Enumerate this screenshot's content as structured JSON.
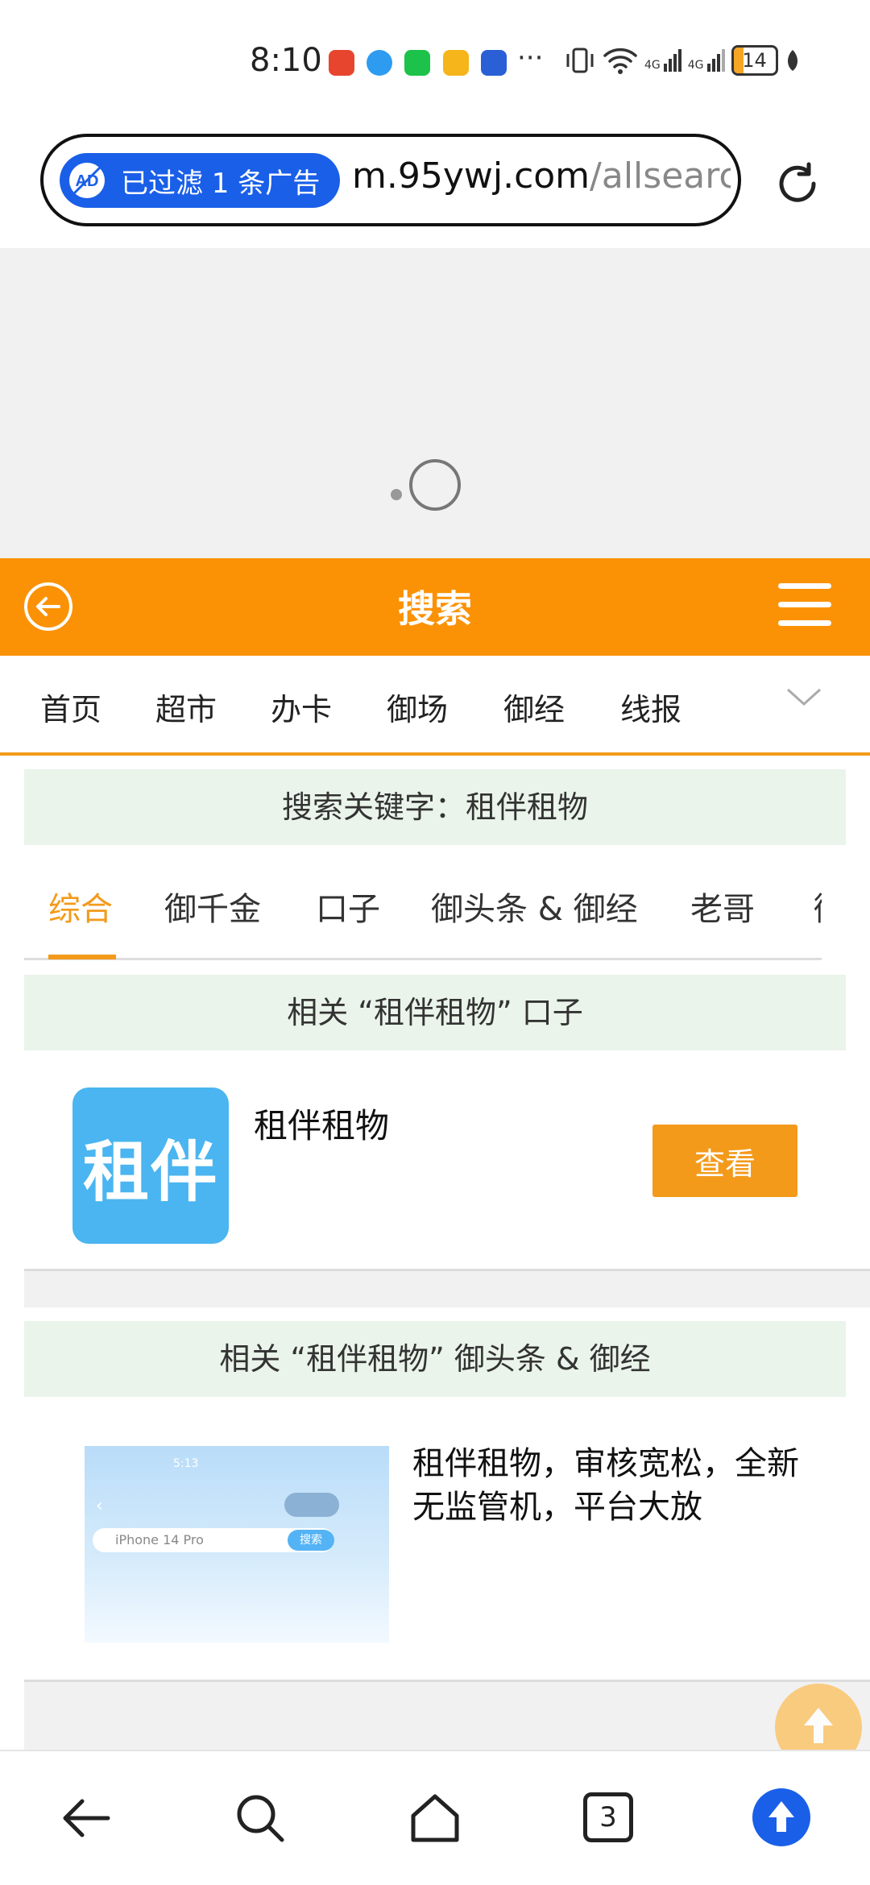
{
  "status_bar": {
    "time": "8:10",
    "notification_icons": [
      "missed-call-icon",
      "message-icon",
      "wechat-icon",
      "mail-icon",
      "shield-app-icon"
    ],
    "more": "···",
    "network": "4G",
    "battery": "14"
  },
  "browser": {
    "ad_filter_label": "已过滤 1 条广告",
    "url_domain": "m.95ywj.com",
    "url_path": "/allsearcl"
  },
  "header": {
    "title": "搜索"
  },
  "nav": {
    "items": [
      "首页",
      "超市",
      "办卡",
      "御场",
      "御经",
      "线报"
    ]
  },
  "search": {
    "keyword_banner": "搜索关键字：租伴租物"
  },
  "tabs": {
    "items": [
      "综合",
      "御千金",
      "口子",
      "御头条 & 御经",
      "老哥",
      "御"
    ],
    "active": "综合"
  },
  "section_kouzi": {
    "title": "相关 “租伴租物” 口子",
    "app_logo_text": "租伴",
    "app_name": "租伴租物",
    "view_button": "查看"
  },
  "section_news": {
    "title": "相关 “租伴租物” 御头条 & 御经",
    "article_title": "租伴租物，审核宽松，全新无监管机，平台大放",
    "thumbnail": {
      "time": "5:13",
      "search_placeholder": "iPhone 14 Pro",
      "search_button": "搜索"
    }
  },
  "bottom_bar": {
    "tab_count": "3"
  },
  "colors": {
    "accent_orange": "#fb9206",
    "banner_green": "#eaf4ea",
    "browser_blue": "#1a5fe8"
  }
}
